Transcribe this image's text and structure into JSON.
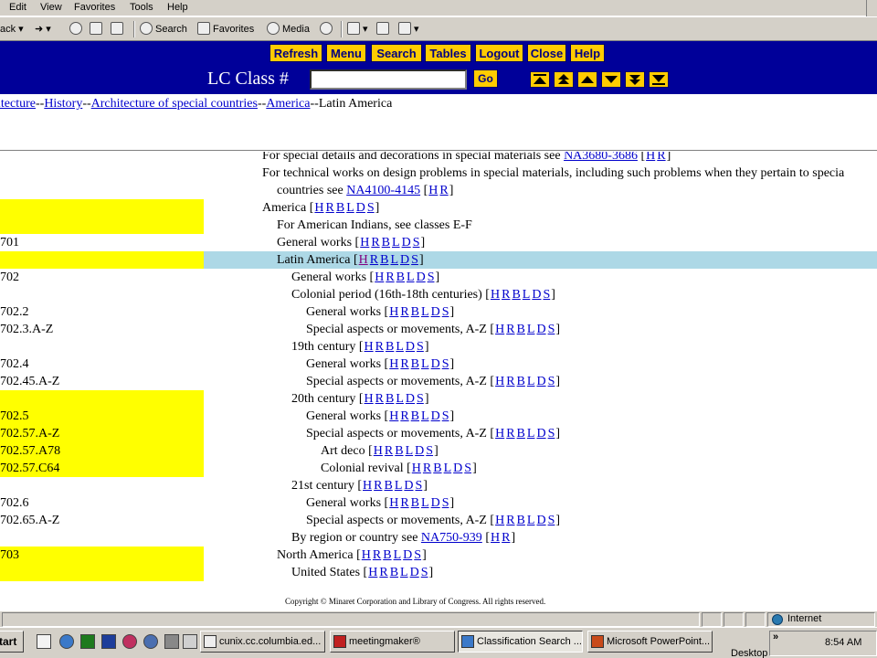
{
  "browser": {
    "menu": [
      "Edit",
      "View",
      "Favorites",
      "Tools",
      "Help"
    ],
    "toolbar": {
      "back": "ack",
      "search": "Search",
      "favorites": "Favorites",
      "media": "Media"
    }
  },
  "nav_buttons": [
    "Refresh",
    "Menu",
    "Search",
    "Tables",
    "Logout",
    "Close",
    "Help"
  ],
  "lc": {
    "label": "LC Class #",
    "go": "Go",
    "input_value": ""
  },
  "breadcrumb": {
    "links": [
      "itecture",
      "History",
      "Architecture of special countries",
      "America"
    ],
    "current": "Latin America",
    "sep": "--"
  },
  "content": {
    "pre_lines": [
      {
        "text": "For special details and decorations in special materials see ",
        "link": "NA3680-3686",
        "hr": "[H R]"
      },
      {
        "text": "For technical works on design problems in special materials, including such problems when they pertain to specia"
      },
      {
        "text": "countries see ",
        "link": "NA4100-4145",
        "hr": "[H R]"
      }
    ],
    "entries": [
      {
        "cls": "",
        "hl": true,
        "text": "America",
        "indent": 0
      },
      {
        "cls": "",
        "hl": true,
        "text": "For American Indians, see classes E-F",
        "indent": 1,
        "nolinks": true
      },
      {
        "cls": "701",
        "text": "General works",
        "indent": 1
      },
      {
        "cls": "",
        "hl": true,
        "text": "Latin America",
        "indent": 1,
        "selected": true
      },
      {
        "cls": "702",
        "text": "General works",
        "indent": 2
      },
      {
        "cls": "",
        "text": "Colonial period (16th-18th centuries)",
        "indent": 2
      },
      {
        "cls": "702.2",
        "text": "General works",
        "indent": 3
      },
      {
        "cls": "702.3.A-Z",
        "text": "Special aspects or movements, A-Z",
        "indent": 3
      },
      {
        "cls": "",
        "text": "19th century",
        "indent": 2
      },
      {
        "cls": "702.4",
        "text": "General works",
        "indent": 3
      },
      {
        "cls": "702.45.A-Z",
        "text": "Special aspects or movements, A-Z",
        "indent": 3
      },
      {
        "cls": "",
        "hl": true,
        "text": "20th century",
        "indent": 2
      },
      {
        "cls": "702.5",
        "hl": true,
        "text": "General works",
        "indent": 3
      },
      {
        "cls": "702.57.A-Z",
        "hl": true,
        "text": "Special aspects or movements, A-Z",
        "indent": 3
      },
      {
        "cls": "702.57.A78",
        "hl": true,
        "text": "Art deco",
        "indent": 4
      },
      {
        "cls": "702.57.C64",
        "hl": true,
        "text": "Colonial revival",
        "indent": 4
      },
      {
        "cls": "",
        "text": "21st century",
        "indent": 2
      },
      {
        "cls": "702.6",
        "text": "General works",
        "indent": 3
      },
      {
        "cls": "702.65.A-Z",
        "text": "Special aspects or movements, A-Z",
        "indent": 3
      },
      {
        "cls": "",
        "text": "By region or country see ",
        "indent": 2,
        "seelink": "NA750-939",
        "hrOnly": true
      },
      {
        "cls": "703",
        "hl": true,
        "text": "North America",
        "indent": 1
      },
      {
        "cls": "",
        "hl": true,
        "text": "United States",
        "indent": 2
      }
    ],
    "hrbld": [
      "H",
      "R",
      "B",
      "L",
      "D",
      "S"
    ]
  },
  "copyright": "Copyright © Minaret Corporation and Library of Congress. All rights reserved.",
  "status": {
    "zone": "Internet"
  },
  "taskbar": {
    "start": "tart",
    "tasks": [
      "cunix.cc.columbia.ed...",
      "meetingmaker®",
      "Classification Search ...",
      "Microsoft PowerPoint..."
    ],
    "desktop": "Desktop",
    "clock": "8:54 AM"
  }
}
